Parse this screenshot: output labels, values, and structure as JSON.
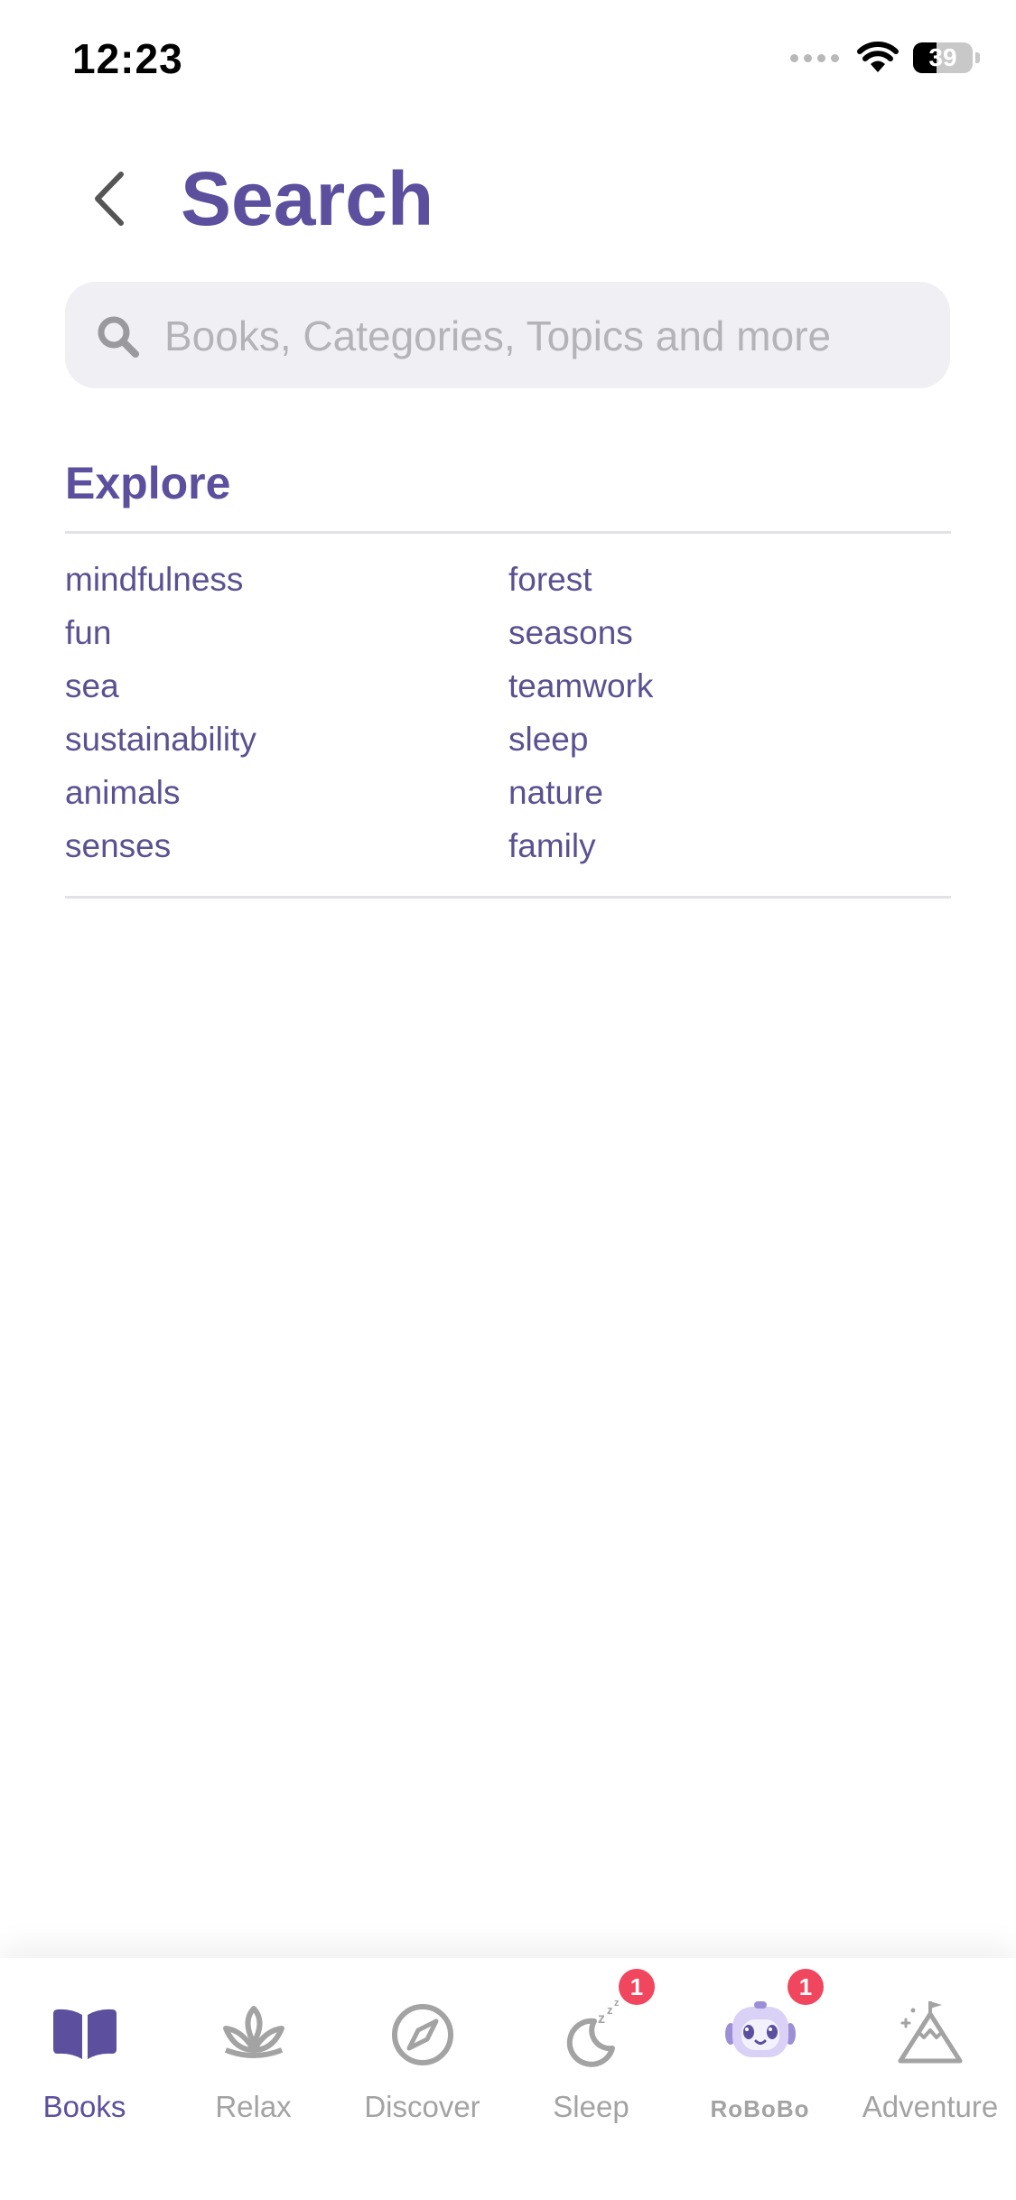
{
  "status_bar": {
    "time": "12:23",
    "battery_level": "39",
    "battery_fraction": 0.39
  },
  "header": {
    "title": "Search",
    "back_icon": "chevron-left-icon"
  },
  "search": {
    "placeholder": "Books, Categories, Topics and more",
    "value": "",
    "icon": "search-icon"
  },
  "explore": {
    "heading": "Explore",
    "topics_left": [
      "mindfulness",
      "fun",
      "sea",
      "sustainability",
      "animals",
      "senses"
    ],
    "topics_right": [
      "forest",
      "seasons",
      "teamwork",
      "sleep",
      "nature",
      "family"
    ]
  },
  "tab_bar": {
    "tabs": [
      {
        "label": "Books",
        "icon": "book-icon",
        "active": true
      },
      {
        "label": "Relax",
        "icon": "lotus-icon",
        "active": false
      },
      {
        "label": "Discover",
        "icon": "compass-icon",
        "active": false
      },
      {
        "label": "Sleep",
        "icon": "moon-icon",
        "active": false,
        "badge": "1"
      },
      {
        "label": "RoBoBo",
        "icon": "robot-icon",
        "active": false,
        "badge": "1"
      },
      {
        "label": "Adventure",
        "icon": "mountain-icon",
        "active": false
      }
    ]
  },
  "colors": {
    "accent": "#5c4f9e",
    "topic_text": "#5a5190",
    "inactive_tab": "#a3a3a3",
    "badge": "#f0465e",
    "search_bg": "#f0f0f4"
  }
}
